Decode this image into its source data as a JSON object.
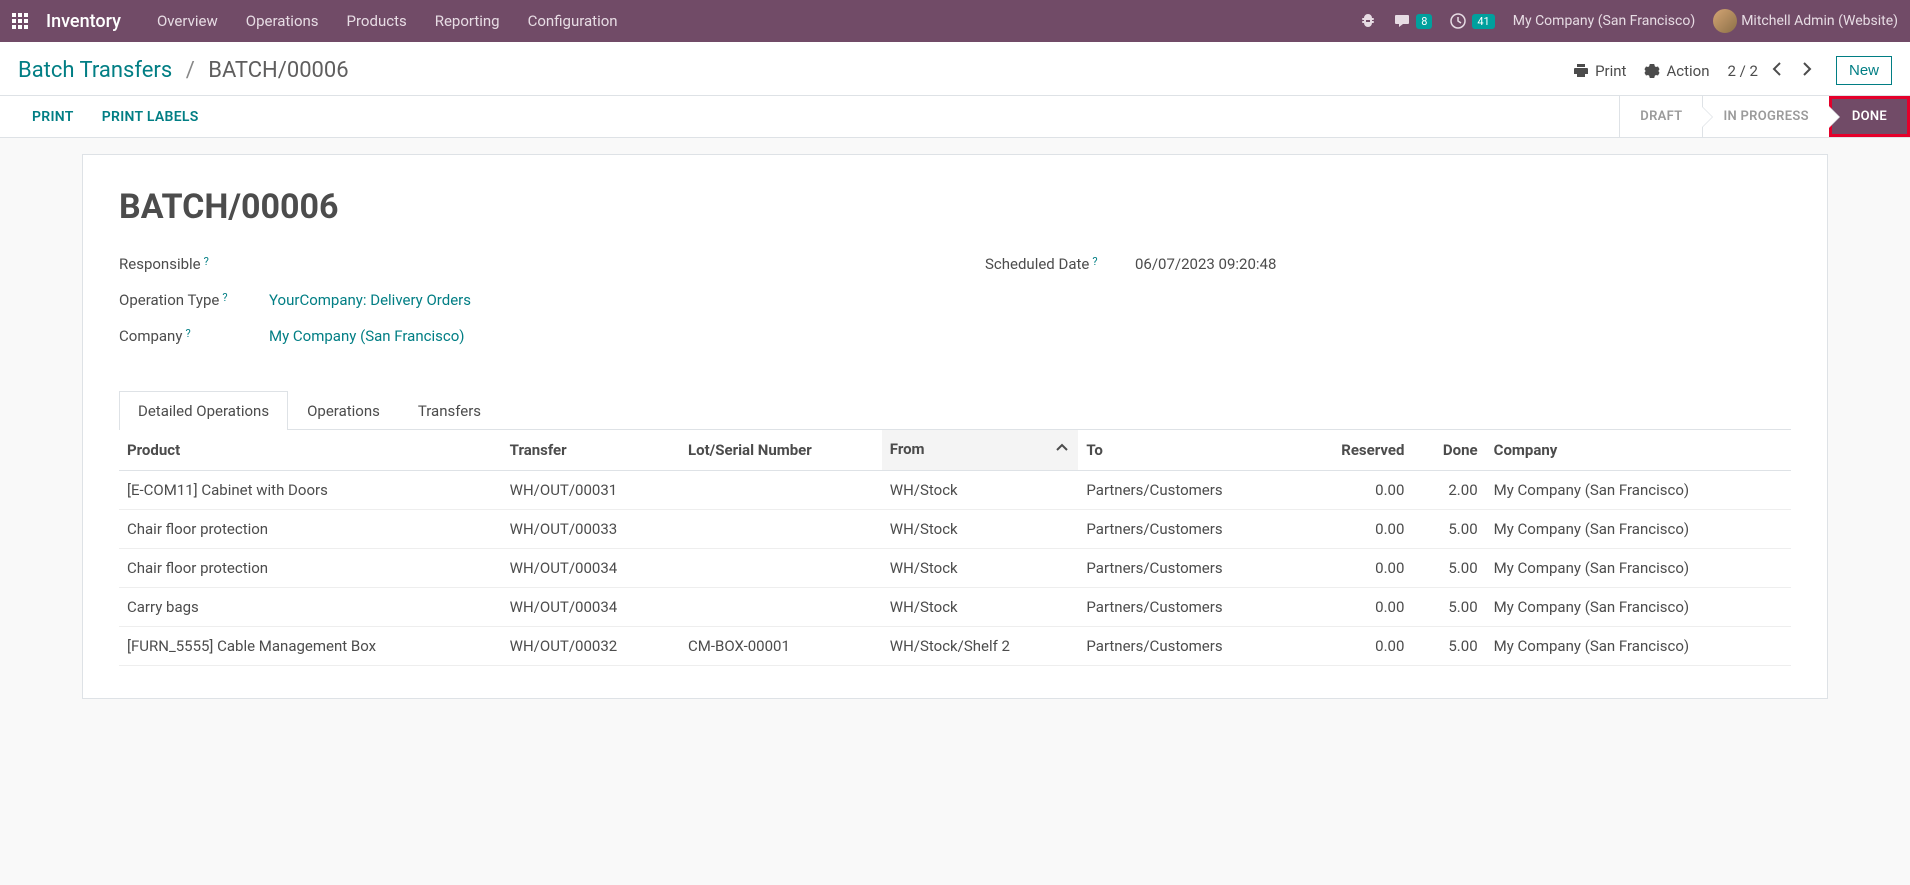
{
  "navbar": {
    "brand": "Inventory",
    "menu": [
      "Overview",
      "Operations",
      "Products",
      "Reporting",
      "Configuration"
    ],
    "messages_badge": "8",
    "activity_badge": "41",
    "company": "My Company (San Francisco)",
    "user": "Mitchell Admin (Website)"
  },
  "breadcrumb": {
    "parent": "Batch Transfers",
    "current": "BATCH/00006"
  },
  "cp": {
    "print": "Print",
    "action": "Action",
    "pager": "2 / 2",
    "new": "New"
  },
  "buttons": {
    "print": "PRINT",
    "print_labels": "PRINT LABELS"
  },
  "status": {
    "draft": "DRAFT",
    "in_progress": "IN PROGRESS",
    "done": "DONE"
  },
  "record": {
    "name": "BATCH/00006",
    "labels": {
      "responsible": "Responsible",
      "scheduled_date": "Scheduled Date",
      "operation_type": "Operation Type",
      "company": "Company"
    },
    "responsible": "",
    "scheduled_date": "06/07/2023 09:20:48",
    "operation_type": "YourCompany: Delivery Orders",
    "company": "My Company (San Francisco)"
  },
  "tabs": {
    "detailed_operations": "Detailed Operations",
    "operations": "Operations",
    "transfers": "Transfers"
  },
  "table": {
    "headers": {
      "product": "Product",
      "transfer": "Transfer",
      "lot": "Lot/Serial Number",
      "from": "From",
      "to": "To",
      "reserved": "Reserved",
      "done": "Done",
      "company": "Company"
    },
    "rows": [
      {
        "product": "[E-COM11] Cabinet with Doors",
        "transfer": "WH/OUT/00031",
        "lot": "",
        "from": "WH/Stock",
        "to": "Partners/Customers",
        "reserved": "0.00",
        "done": "2.00",
        "company": "My Company (San Francisco)"
      },
      {
        "product": "Chair floor protection",
        "transfer": "WH/OUT/00033",
        "lot": "",
        "from": "WH/Stock",
        "to": "Partners/Customers",
        "reserved": "0.00",
        "done": "5.00",
        "company": "My Company (San Francisco)"
      },
      {
        "product": "Chair floor protection",
        "transfer": "WH/OUT/00034",
        "lot": "",
        "from": "WH/Stock",
        "to": "Partners/Customers",
        "reserved": "0.00",
        "done": "5.00",
        "company": "My Company (San Francisco)"
      },
      {
        "product": "Carry bags",
        "transfer": "WH/OUT/00034",
        "lot": "",
        "from": "WH/Stock",
        "to": "Partners/Customers",
        "reserved": "0.00",
        "done": "5.00",
        "company": "My Company (San Francisco)"
      },
      {
        "product": "[FURN_5555] Cable Management Box",
        "transfer": "WH/OUT/00032",
        "lot": "CM-BOX-00001",
        "from": "WH/Stock/Shelf 2",
        "to": "Partners/Customers",
        "reserved": "0.00",
        "done": "5.00",
        "company": "My Company (San Francisco)"
      }
    ]
  }
}
